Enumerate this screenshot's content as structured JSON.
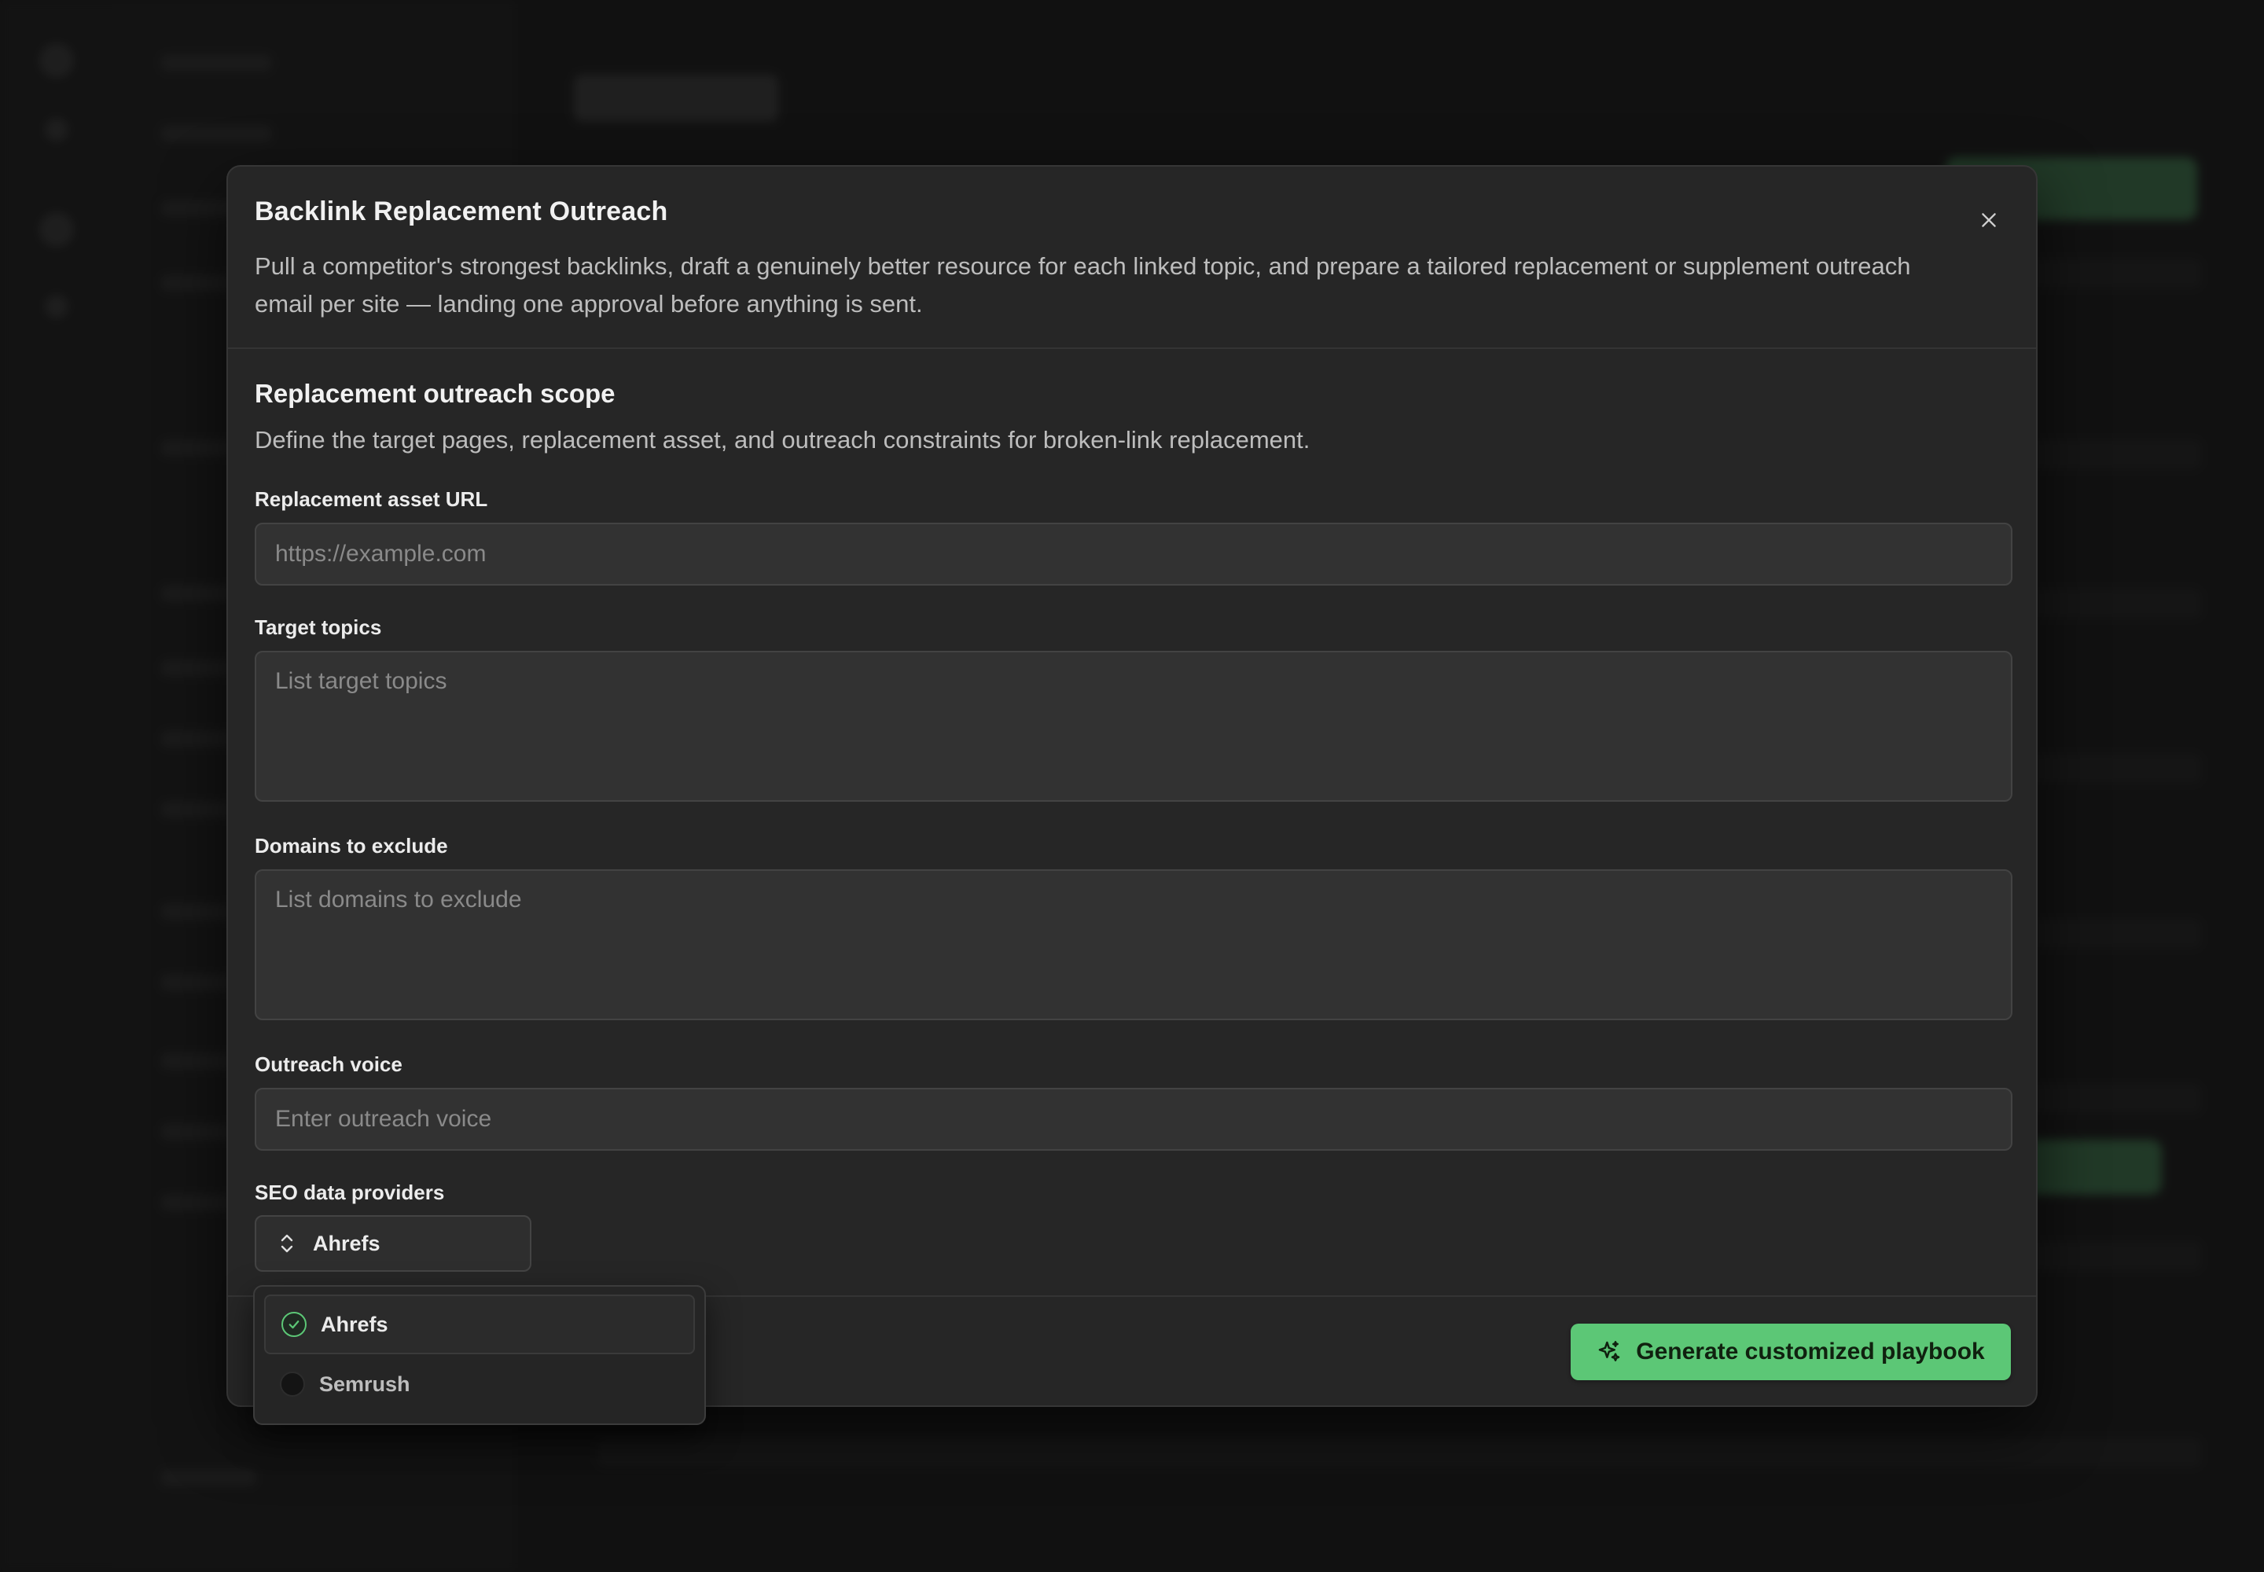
{
  "modal": {
    "title": "Backlink Replacement Outreach",
    "description": "Pull a competitor's strongest backlinks, draft a genuinely better resource for each linked topic, and prepare a tailored replacement or supplement outreach email per site — landing one approval before anything is sent.",
    "close_icon": "close-icon"
  },
  "section": {
    "title": "Replacement outreach scope",
    "description": "Define the target pages, replacement asset, and outreach constraints for broken-link replacement."
  },
  "fields": {
    "asset_url": {
      "label": "Replacement asset URL",
      "placeholder": "https://example.com",
      "value": ""
    },
    "target_topics": {
      "label": "Target topics",
      "placeholder": "List target topics",
      "value": ""
    },
    "exclude_domains": {
      "label": "Domains to exclude",
      "placeholder": "List domains to exclude",
      "value": ""
    },
    "outreach_voice": {
      "label": "Outreach voice",
      "placeholder": "Enter outreach voice",
      "value": ""
    }
  },
  "providers": {
    "label": "SEO data providers",
    "selected": "Ahrefs",
    "icon": "chevron-up-down-icon",
    "options": [
      {
        "label": "Ahrefs",
        "checked": true
      },
      {
        "label": "Semrush",
        "checked": false
      }
    ]
  },
  "footer": {
    "primary_label": "Generate customized playbook",
    "primary_icon": "sparkles-icon"
  },
  "colors": {
    "accent": "#5cc776",
    "modal_bg": "#262626",
    "page_bg": "#111111"
  }
}
